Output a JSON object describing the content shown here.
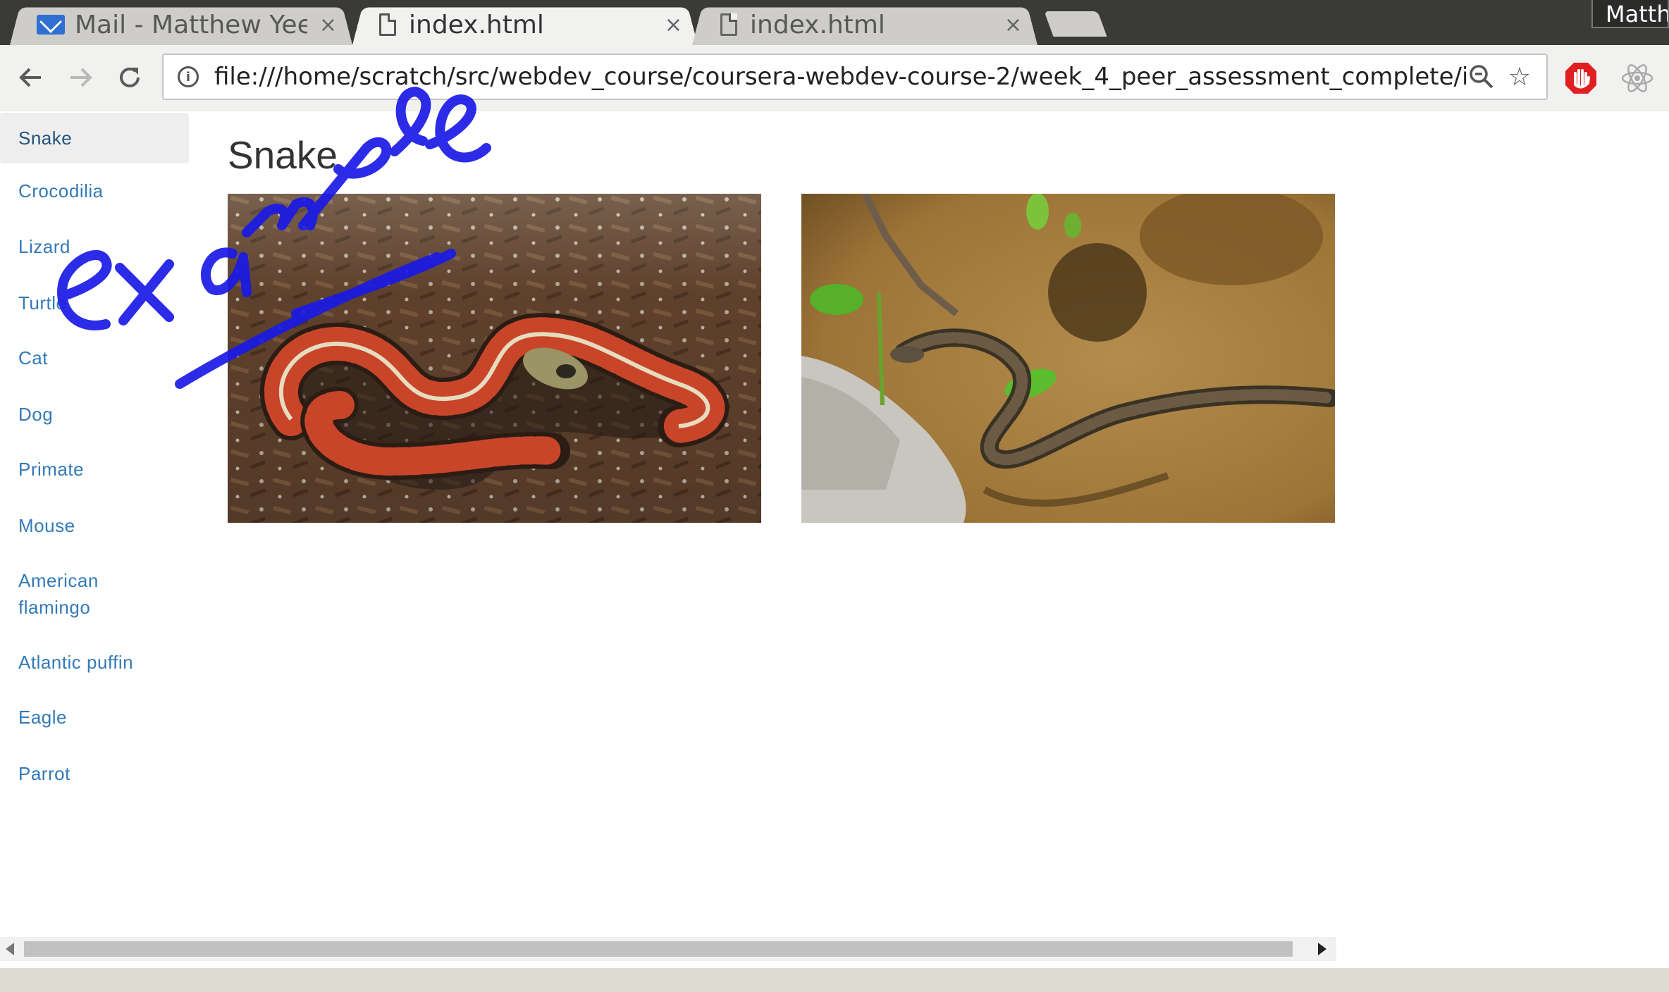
{
  "tabs": [
    {
      "title": "Mail - Matthew Yee",
      "close": "×",
      "icon": "mail-icon"
    },
    {
      "title": "index.html",
      "close": "×",
      "icon": "document-icon",
      "active": true
    },
    {
      "title": "index.html",
      "close": "×",
      "icon": "document-icon"
    }
  ],
  "profile_name": "Matth",
  "toolbar": {
    "back": "←",
    "forward": "→",
    "reload": "⟳",
    "url": "file:///home/scratch/src/webdev_course/coursera-webdev-course-2/week_4_peer_assessment_complete/index.",
    "info": "i",
    "zoom": "zoom-out-icon",
    "bookmark": "☆"
  },
  "sidebar": {
    "items": [
      {
        "label": "Snake",
        "active": true
      },
      {
        "label": "Crocodilia"
      },
      {
        "label": "Lizard"
      },
      {
        "label": "Turtle"
      },
      {
        "label": "Cat"
      },
      {
        "label": "Dog"
      },
      {
        "label": "Primate"
      },
      {
        "label": "Mouse"
      },
      {
        "label": "American flamingo"
      },
      {
        "label": "Atlantic puffin"
      },
      {
        "label": "Eagle"
      },
      {
        "label": "Parrot"
      }
    ]
  },
  "main": {
    "heading": "Snake",
    "images": [
      {
        "name": "garter-snake-photo"
      },
      {
        "name": "water-snake-photo"
      }
    ]
  },
  "annotation": {
    "text": "example",
    "color": "#1a1ae6"
  },
  "colors": {
    "link": "#337ab7",
    "active_bg": "#eeeeee",
    "tabstrip": "#3a3a38"
  }
}
